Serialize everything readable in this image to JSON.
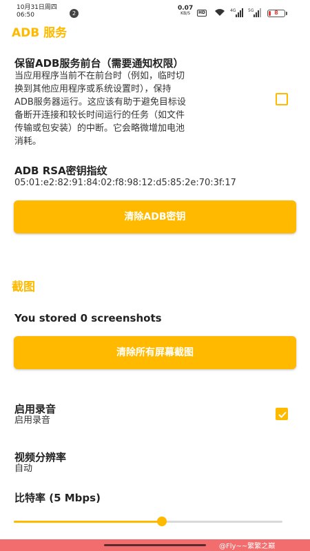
{
  "status_bar": {
    "date": "10月31日周四",
    "time": "06:50",
    "notification_count": "2",
    "net_speed": "0.07",
    "net_unit": "KB/S",
    "hd_label": "HD",
    "signal1_label": "4G",
    "signal2_label": "5G",
    "battery": "8"
  },
  "adb_section": {
    "header": "ADB 服务",
    "keep_foreground": {
      "title": "保留ADB服务前台（需要通知权限）",
      "summary_lines": [
        "当应用程序当前不在前台时（例如，临时切",
        "换到其他应用程序或系统设置时），保持",
        "ADB服务器运行。这应该有助于避免目标设",
        "备断开连接和较长时间运行的任务（如文件",
        "传输或包安装）的中断。它会略微增加电池",
        "消耗。"
      ],
      "checked": false
    },
    "rsa": {
      "title": "ADB RSA密钥指纹",
      "fingerprint": "05:01:e2:82:91:84:02:f8:98:12:d5:85:2e:70:3f:17"
    },
    "clear_key_button": "清除ADB密钥"
  },
  "screenshot_section": {
    "header": "截图",
    "stored_text": "You stored 0 screenshots",
    "clear_button": "清除所有屏幕截图"
  },
  "recording": {
    "enable_audio": {
      "title": "启用录音",
      "summary": "启用录音",
      "checked": true
    },
    "resolution": {
      "title": "视频分辨率",
      "value": "自动"
    },
    "bitrate": {
      "title": "比特率 (5 Mbps)",
      "slider_fraction": 0.55
    }
  },
  "watermark": "@Fly~~繁繁之巅",
  "colors": {
    "accent": "#ffba00",
    "bottom_bar": "#f26d6d"
  }
}
